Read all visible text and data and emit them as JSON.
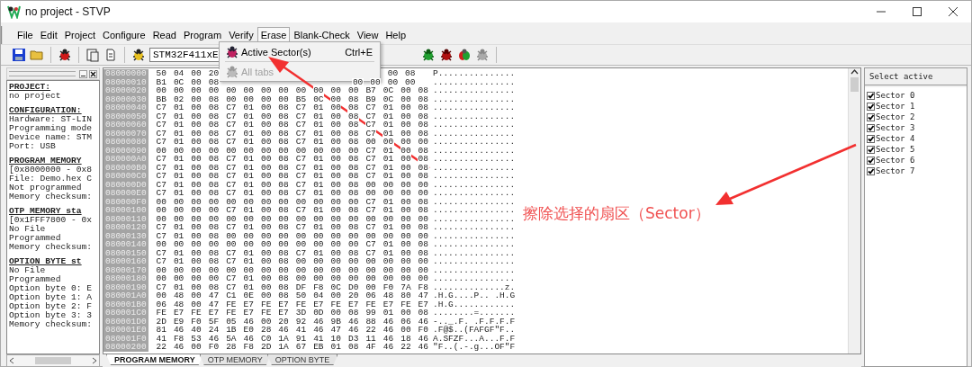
{
  "window": {
    "title": "no project - STVP"
  },
  "menu": [
    {
      "label": "File",
      "open": false
    },
    {
      "label": "Edit",
      "open": false
    },
    {
      "label": "Project",
      "open": false
    },
    {
      "label": "Configure",
      "open": false
    },
    {
      "label": "Read",
      "open": false
    },
    {
      "label": "Program",
      "open": false
    },
    {
      "label": "Verify",
      "open": false
    },
    {
      "label": "Erase",
      "open": true
    },
    {
      "label": "Blank-Check",
      "open": false
    },
    {
      "label": "View",
      "open": false
    },
    {
      "label": "Help",
      "open": false
    }
  ],
  "erase_menu": [
    {
      "label": "Active Sector(s)",
      "shortcut": "Ctrl+E",
      "disabled": false
    },
    {
      "label": "All tabs",
      "disabled": true
    }
  ],
  "toolbar": {
    "device": "STM32F411xE"
  },
  "info_panel": [
    {
      "heading": "PROJECT:",
      "lines": [
        "no project"
      ]
    },
    {
      "heading": "CONFIGURATION:",
      "lines": [
        "Hardware: ST-LIN",
        "Programming mode",
        "Device name: STM",
        "Port: USB"
      ]
    },
    {
      "heading": "PROGRAM MEMORY",
      "lines": [
        "[0x8000000 - 0x8",
        "File: Demo.hex C",
        "Not programmed",
        "Memory checksum:"
      ]
    },
    {
      "heading": "OTP MEMORY sta",
      "lines": [
        "[0x1FFF7800 - 0x",
        "No File",
        "Programmed",
        "Memory checksum:"
      ]
    },
    {
      "heading": "OPTION BYTE st",
      "lines": [
        "No File",
        "Programmed",
        "Option byte 0: E",
        "Option byte 1: A",
        "Option byte 2: F",
        "Option byte 3: 3",
        "Memory checksum:"
      ]
    }
  ],
  "memory_rows": [
    {
      "address": "08000000",
      "bytes": [
        "50",
        "04",
        "00",
        "20"
      ],
      "bytes_after_menu": [
        "00",
        "08"
      ],
      "ascii": "P..............."
    },
    {
      "address": "08000010",
      "bytes": [
        "B1",
        "0C",
        "00",
        "08"
      ],
      "bytes_after_menu": [
        "00",
        "00",
        "00",
        "00"
      ],
      "ascii": "................"
    },
    {
      "address": "08000020",
      "bytes": [
        "00",
        "00",
        "00",
        "00",
        "00",
        "00",
        "00",
        "00",
        "00",
        "00",
        "00",
        "00",
        "B7",
        "0C",
        "00",
        "08"
      ],
      "ascii": "................"
    },
    {
      "address": "08000030",
      "bytes": [
        "BB",
        "02",
        "00",
        "08",
        "00",
        "00",
        "00",
        "00",
        "B5",
        "0C",
        "00",
        "08",
        "B9",
        "0C",
        "00",
        "08"
      ],
      "ascii": "................"
    },
    {
      "address": "08000040",
      "bytes": [
        "C7",
        "01",
        "00",
        "08",
        "C7",
        "01",
        "00",
        "08",
        "C7",
        "01",
        "00",
        "08",
        "C7",
        "01",
        "00",
        "08"
      ],
      "ascii": "................"
    },
    {
      "address": "08000050",
      "bytes": [
        "C7",
        "01",
        "00",
        "08",
        "C7",
        "01",
        "00",
        "08",
        "C7",
        "01",
        "00",
        "08",
        "C7",
        "01",
        "00",
        "08"
      ],
      "ascii": "................"
    },
    {
      "address": "08000060",
      "bytes": [
        "C7",
        "01",
        "00",
        "08",
        "C7",
        "01",
        "00",
        "08",
        "C7",
        "01",
        "00",
        "08",
        "C7",
        "01",
        "00",
        "08"
      ],
      "ascii": "................"
    },
    {
      "address": "08000070",
      "bytes": [
        "C7",
        "01",
        "00",
        "08",
        "C7",
        "01",
        "00",
        "08",
        "C7",
        "01",
        "00",
        "08",
        "C7",
        "01",
        "00",
        "08"
      ],
      "ascii": "................"
    },
    {
      "address": "08000080",
      "bytes": [
        "C7",
        "01",
        "00",
        "08",
        "C7",
        "01",
        "00",
        "08",
        "C7",
        "01",
        "00",
        "08",
        "00",
        "00",
        "00",
        "00"
      ],
      "ascii": "................"
    },
    {
      "address": "08000090",
      "bytes": [
        "00",
        "00",
        "00",
        "00",
        "00",
        "00",
        "00",
        "00",
        "00",
        "00",
        "00",
        "00",
        "C7",
        "01",
        "00",
        "08"
      ],
      "ascii": "................"
    },
    {
      "address": "080000A0",
      "bytes": [
        "C7",
        "01",
        "00",
        "08",
        "C7",
        "01",
        "00",
        "08",
        "C7",
        "01",
        "00",
        "08",
        "C7",
        "01",
        "00",
        "08"
      ],
      "ascii": "................"
    },
    {
      "address": "080000B0",
      "bytes": [
        "C7",
        "01",
        "00",
        "08",
        "C7",
        "01",
        "00",
        "08",
        "C7",
        "01",
        "00",
        "08",
        "C7",
        "01",
        "00",
        "08"
      ],
      "ascii": "................"
    },
    {
      "address": "080000C0",
      "bytes": [
        "C7",
        "01",
        "00",
        "08",
        "C7",
        "01",
        "00",
        "08",
        "C7",
        "01",
        "00",
        "08",
        "C7",
        "01",
        "00",
        "08"
      ],
      "ascii": "................"
    },
    {
      "address": "080000D0",
      "bytes": [
        "C7",
        "01",
        "00",
        "08",
        "C7",
        "01",
        "00",
        "08",
        "C7",
        "01",
        "00",
        "08",
        "00",
        "00",
        "00",
        "00"
      ],
      "ascii": "................"
    },
    {
      "address": "080000E0",
      "bytes": [
        "C7",
        "01",
        "00",
        "08",
        "C7",
        "01",
        "00",
        "08",
        "C7",
        "01",
        "00",
        "08",
        "00",
        "00",
        "00",
        "00"
      ],
      "ascii": "................"
    },
    {
      "address": "080000F0",
      "bytes": [
        "00",
        "00",
        "00",
        "00",
        "00",
        "00",
        "00",
        "00",
        "00",
        "00",
        "00",
        "00",
        "C7",
        "01",
        "00",
        "08"
      ],
      "ascii": "................"
    },
    {
      "address": "08000100",
      "bytes": [
        "00",
        "00",
        "00",
        "00",
        "C7",
        "01",
        "00",
        "08",
        "C7",
        "01",
        "00",
        "08",
        "C7",
        "01",
        "00",
        "08"
      ],
      "ascii": "................"
    },
    {
      "address": "08000110",
      "bytes": [
        "00",
        "00",
        "00",
        "00",
        "00",
        "00",
        "00",
        "00",
        "00",
        "00",
        "00",
        "00",
        "00",
        "00",
        "00",
        "00"
      ],
      "ascii": "................"
    },
    {
      "address": "08000120",
      "bytes": [
        "C7",
        "01",
        "00",
        "08",
        "C7",
        "01",
        "00",
        "08",
        "C7",
        "01",
        "00",
        "08",
        "C7",
        "01",
        "00",
        "08"
      ],
      "ascii": "................"
    },
    {
      "address": "08000130",
      "bytes": [
        "C7",
        "01",
        "00",
        "08",
        "00",
        "00",
        "00",
        "00",
        "00",
        "00",
        "00",
        "00",
        "00",
        "00",
        "00",
        "00"
      ],
      "ascii": "................"
    },
    {
      "address": "08000140",
      "bytes": [
        "00",
        "00",
        "00",
        "00",
        "00",
        "00",
        "00",
        "00",
        "00",
        "00",
        "00",
        "00",
        "C7",
        "01",
        "00",
        "08"
      ],
      "ascii": "................"
    },
    {
      "address": "08000150",
      "bytes": [
        "C7",
        "01",
        "00",
        "08",
        "C7",
        "01",
        "00",
        "08",
        "C7",
        "01",
        "00",
        "08",
        "C7",
        "01",
        "00",
        "08"
      ],
      "ascii": "................"
    },
    {
      "address": "08000160",
      "bytes": [
        "C7",
        "01",
        "00",
        "08",
        "C7",
        "01",
        "00",
        "08",
        "00",
        "00",
        "00",
        "00",
        "00",
        "00",
        "00",
        "00"
      ],
      "ascii": "................"
    },
    {
      "address": "08000170",
      "bytes": [
        "00",
        "00",
        "00",
        "00",
        "00",
        "00",
        "00",
        "00",
        "00",
        "00",
        "00",
        "00",
        "00",
        "00",
        "00",
        "00"
      ],
      "ascii": "................"
    },
    {
      "address": "08000180",
      "bytes": [
        "00",
        "00",
        "00",
        "00",
        "C7",
        "01",
        "00",
        "08",
        "00",
        "00",
        "00",
        "00",
        "00",
        "00",
        "00",
        "00"
      ],
      "ascii": "................"
    },
    {
      "address": "08000190",
      "bytes": [
        "C7",
        "01",
        "00",
        "08",
        "C7",
        "01",
        "00",
        "08",
        "DF",
        "F8",
        "0C",
        "D0",
        "00",
        "F0",
        "7A",
        "F8"
      ],
      "ascii": "..............z."
    },
    {
      "address": "080001A0",
      "bytes": [
        "00",
        "48",
        "00",
        "47",
        "C1",
        "0E",
        "00",
        "08",
        "50",
        "04",
        "00",
        "20",
        "06",
        "48",
        "80",
        "47"
      ],
      "ascii": ".H.G....P.. .H.G"
    },
    {
      "address": "080001B0",
      "bytes": [
        "06",
        "48",
        "00",
        "47",
        "FE",
        "E7",
        "FE",
        "E7",
        "FE",
        "E7",
        "FE",
        "E7",
        "FE",
        "E7",
        "FE",
        "E7"
      ],
      "ascii": ".H.G............"
    },
    {
      "address": "080001C0",
      "bytes": [
        "FE",
        "E7",
        "FE",
        "E7",
        "FE",
        "E7",
        "FE",
        "E7",
        "3D",
        "0D",
        "00",
        "08",
        "99",
        "01",
        "00",
        "08"
      ],
      "ascii": "........=......."
    },
    {
      "address": "080001D0",
      "bytes": [
        "2D",
        "E9",
        "F0",
        "5F",
        "05",
        "46",
        "00",
        "20",
        "92",
        "46",
        "9B",
        "46",
        "88",
        "46",
        "06",
        "46"
      ],
      "ascii": "-.._.F. .F.F.F.F"
    },
    {
      "address": "080001E0",
      "bytes": [
        "81",
        "46",
        "40",
        "24",
        "1B",
        "E0",
        "28",
        "46",
        "41",
        "46",
        "47",
        "46",
        "22",
        "46",
        "00",
        "F0"
      ],
      "ascii": ".F@$..(FAFGF\"F.."
    },
    {
      "address": "080001F0",
      "bytes": [
        "41",
        "F8",
        "53",
        "46",
        "5A",
        "46",
        "C0",
        "1A",
        "91",
        "41",
        "10",
        "D3",
        "11",
        "46",
        "18",
        "46"
      ],
      "ascii": "A.SFZF...A...F.F"
    },
    {
      "address": "08000200",
      "bytes": [
        "22",
        "46",
        "00",
        "F0",
        "28",
        "F8",
        "2D",
        "1A",
        "67",
        "EB",
        "01",
        "08",
        "4F",
        "46",
        "22",
        "46"
      ],
      "ascii": "\"F..(.-.g...OF\"F"
    }
  ],
  "memory_tabs": [
    {
      "label": "PROGRAM MEMORY",
      "selected": true
    },
    {
      "label": "OTP MEMORY",
      "selected": false
    },
    {
      "label": "OPTION BYTE",
      "selected": false
    }
  ],
  "sector_panel": {
    "title": "Select active",
    "sectors": [
      {
        "label": "Sector 0",
        "checked": true
      },
      {
        "label": "Sector 1",
        "checked": true
      },
      {
        "label": "Sector 2",
        "checked": true
      },
      {
        "label": "Sector 3",
        "checked": true
      },
      {
        "label": "Sector 4",
        "checked": true
      },
      {
        "label": "Sector 5",
        "checked": true
      },
      {
        "label": "Sector 6",
        "checked": true
      },
      {
        "label": "Sector 7",
        "checked": true
      }
    ]
  },
  "annotation": {
    "text": "擦除选择的扇区（Sector）"
  }
}
